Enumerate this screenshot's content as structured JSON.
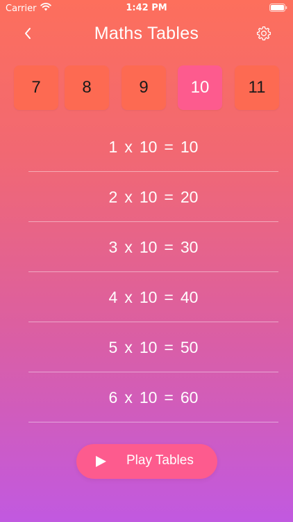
{
  "status_bar": {
    "carrier": "Carrier",
    "time": "1:42 PM",
    "icons": [
      "wifi-icon",
      "battery-icon"
    ]
  },
  "header": {
    "title": "Maths Tables",
    "back_icon": "chevron-left-icon",
    "settings_icon": "gear-icon"
  },
  "numbers": {
    "items": [
      "7",
      "8",
      "9",
      "10",
      "11"
    ],
    "selected": "10"
  },
  "table": {
    "rows": [
      {
        "a": "1",
        "op": "x",
        "b": "10",
        "eq": "=",
        "result": "10"
      },
      {
        "a": "2",
        "op": "x",
        "b": "10",
        "eq": "=",
        "result": "20"
      },
      {
        "a": "3",
        "op": "x",
        "b": "10",
        "eq": "=",
        "result": "30"
      },
      {
        "a": "4",
        "op": "x",
        "b": "10",
        "eq": "=",
        "result": "40"
      },
      {
        "a": "5",
        "op": "x",
        "b": "10",
        "eq": "=",
        "result": "50"
      },
      {
        "a": "6",
        "op": "x",
        "b": "10",
        "eq": "=",
        "result": "60"
      }
    ]
  },
  "play_button": {
    "label": "Play Tables",
    "icon": "play-icon"
  },
  "colors": {
    "gradient_top": "#fd6f5c",
    "gradient_bottom": "#c159e0",
    "tile": "#fd6a52",
    "tile_active": "#fd5b8e",
    "button": "#fd5b8e"
  }
}
